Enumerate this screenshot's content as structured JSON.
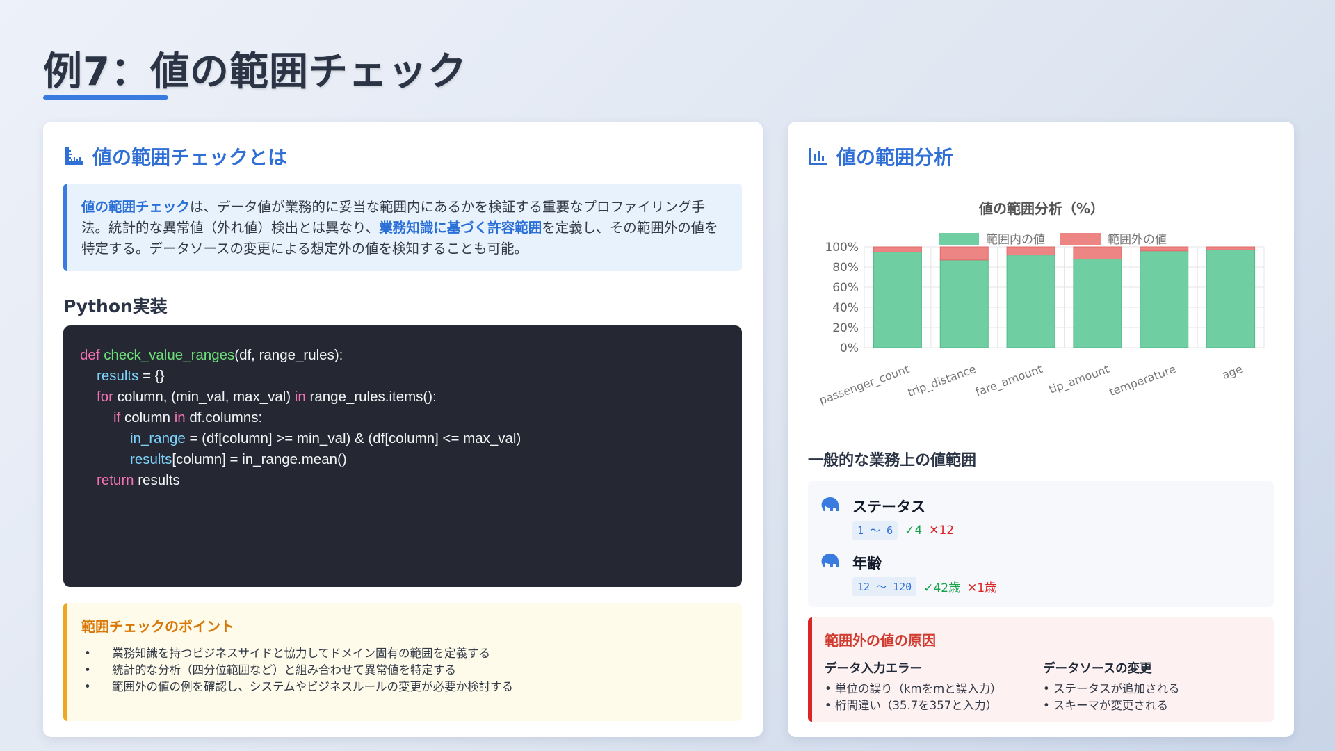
{
  "page": {
    "title": "例7：値の範囲チェック"
  },
  "left_card": {
    "heading": "値の範囲チェックとは",
    "heading_icon": "ruler-icon",
    "intro": {
      "hl1": "値の範囲チェック",
      "t1": "は、データ値が業務的に妥当な範囲内にあるかを検証する重要なプロファイリング手法。統計的な異常値（外れ値）検出とは異なり、",
      "hl2": "業務知識に基づく許容範囲",
      "t2": "を定義し、その範囲外の値を特定する。データソースの変更による想定外の値を検知することも可能。"
    },
    "code_heading": "Python実装",
    "code": {
      "l1_kw": "def ",
      "l1_fn": "check_value_ranges",
      "l1_rest": "(df, range_rules):",
      "l2_var": "results",
      "l2_rest": " = {}",
      "l3_kw": "for",
      "l3_mid": " column, (min_val, max_val) ",
      "l3_kw2": "in",
      "l3_rest": " range_rules.items():",
      "l4_kw": "if",
      "l4_mid": " column ",
      "l4_kw2": "in",
      "l4_rest": " df.columns:",
      "l5_var": "in_range",
      "l5_rest": " = (df[column] >= min_val) & (df[column] <= max_val)",
      "l6_var": "results",
      "l6_rest": "[column] = in_range.mean()",
      "l7_kw": "return",
      "l7_rest": " results"
    },
    "tips": {
      "title": "範囲チェックのポイント",
      "bullet": "•",
      "items": [
        "業務知識を持つビジネスサイドと協力してドメイン固有の範囲を定義する",
        "統計的な分析（四分位範囲など）と組み合わせて異常値を特定する",
        "範囲外の値の例を確認し、システムやビジネスルールの変更が必要か検討する"
      ]
    }
  },
  "right_card": {
    "heading": "値の範囲分析",
    "heading_icon": "bar-chart-icon",
    "ranges_heading": "一般的な業務上の値範囲",
    "ranges": [
      {
        "name": "ステータス",
        "range": "1 〜 6",
        "ok": "✓4",
        "ng": "✕12",
        "icon": "elephant-icon"
      },
      {
        "name": "年齢",
        "range": "12 〜 120",
        "ok": "✓42歳",
        "ng": "✕1歳",
        "icon": "elephant-icon"
      }
    ],
    "cause": {
      "title": "範囲外の値の原因",
      "col1_title": "データ入力エラー",
      "col1_items": [
        "• 単位の誤り（kmをmと誤入力）",
        "• 桁間違い（35.7を357と入力）"
      ],
      "col2_title": "データソースの変更",
      "col2_items": [
        "• ステータスが追加される",
        "• スキーマが変更される"
      ]
    }
  },
  "chart_data": {
    "type": "bar",
    "stacked": true,
    "title": "値の範囲分析（%）",
    "categories": [
      "passenger_count",
      "trip_distance",
      "fare_amount",
      "tip_amount",
      "temperature",
      "age"
    ],
    "series": [
      {
        "name": "範囲内の値",
        "color": "#6fcfa3",
        "values": [
          95,
          87,
          92,
          88,
          96,
          97
        ]
      },
      {
        "name": "範囲外の値",
        "color": "#ee8585",
        "values": [
          5,
          13,
          8,
          12,
          4,
          3
        ]
      }
    ],
    "yticks": [
      "0%",
      "20%",
      "40%",
      "60%",
      "80%",
      "100%"
    ],
    "ylim": [
      0,
      100
    ],
    "legend_position": "top",
    "grid": true
  }
}
